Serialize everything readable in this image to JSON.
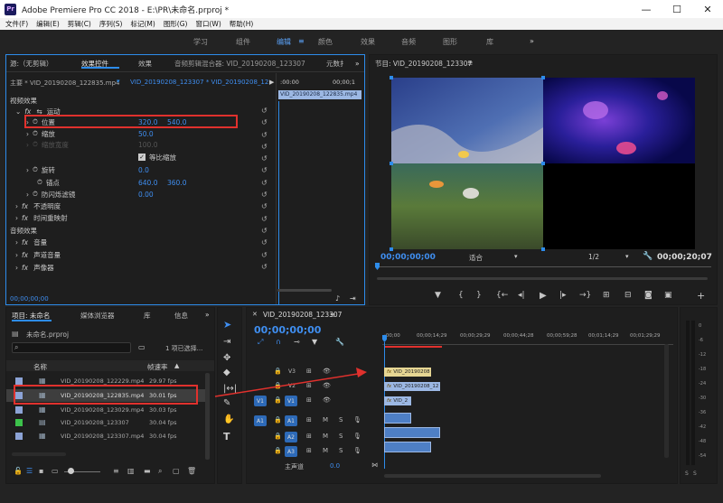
{
  "window": {
    "title": "Adobe Premiere Pro CC 2018 - E:\\PR\\未命名.prproj *",
    "logo": "Pr",
    "controls": [
      "—",
      "☐",
      "✕"
    ]
  },
  "menu": [
    "文件(F)",
    "编辑(E)",
    "剪辑(C)",
    "序列(S)",
    "标记(M)",
    "图形(G)",
    "窗口(W)",
    "帮助(H)"
  ],
  "workspaces": [
    "学习",
    "组件",
    "编辑",
    "颜色",
    "效果",
    "音频",
    "图形",
    "库"
  ],
  "workspace_more": "»",
  "source_panel": {
    "tabs": [
      "源:（无剪辑）",
      "效果控件",
      "效果",
      "音频剪辑混合器: VID_20190208_123307",
      "元数扌"
    ],
    "more": "»",
    "master_label": "主要 * VID_20190208_122835.mp4",
    "sequence_label": "VID_20190208_123307 * VID_20190208_122...",
    "timecode_start": ":00:00",
    "timecode_end": "00;00;1",
    "clip_name": "VID_20190208_122835.mp4",
    "video_effects": "视频效果",
    "motion": "运动",
    "position": {
      "label": "位置",
      "x": "320.0",
      "y": "540.0"
    },
    "scale": {
      "label": "缩放",
      "value": "50.0"
    },
    "scale_width": {
      "label": "缩放宽度",
      "value": "100.0"
    },
    "uniform_scale": "等比缩放",
    "rotation": {
      "label": "旋转",
      "value": "0.0"
    },
    "anchor": {
      "label": "锚点",
      "x": "640.0",
      "y": "360.0"
    },
    "flicker": {
      "label": "防闪烁滤镜",
      "value": "0.00"
    },
    "opacity": "不透明度",
    "time_remap": "时间重映射",
    "audio_effects": "音频效果",
    "volume": "音量",
    "channel_volume": "声道音量",
    "panner": "声像器",
    "footer_time": "00;00;00;00"
  },
  "program_panel": {
    "tab": "节目: VID_20190208_123307",
    "tab_menu": "≡",
    "timecode": "00;00;00;00",
    "fit": "适合",
    "resolution": "1/2",
    "duration": "00;00;20;07"
  },
  "project_panel": {
    "tabs": [
      "项目: 未命名",
      "媒体浏览器",
      "库",
      "信息"
    ],
    "more": "»",
    "project_file": "未命名.prproj",
    "selection_info": "1 项已选择...",
    "col_name": "名称",
    "col_fps": "帧速率",
    "sort_arrow": "▲",
    "items": [
      {
        "name": "VID_20190208_122229.mp4",
        "fps": "29.97 fps",
        "color": "#8ca3d6"
      },
      {
        "name": "VID_20190208_122835.mp4",
        "fps": "30.01 fps",
        "color": "#8ca3d6"
      },
      {
        "name": "VID_20190208_123029.mp4",
        "fps": "30.03 fps",
        "color": "#8ca3d6"
      },
      {
        "name": "VID_20190208_123307",
        "fps": "30.04 fps",
        "color": "#3cc24b"
      },
      {
        "name": "VID_20190208_123307.mp4",
        "fps": "30.04 fps",
        "color": "#8ca3d6"
      }
    ]
  },
  "timeline": {
    "tab": "VID_20190208_123307",
    "tab_menu": "≡",
    "timecode": "00;00;00;00",
    "ruler": [
      ":00;00",
      "00;00;14;29",
      "00;00;29;29",
      "00;00;44;28",
      "00;00;59;28",
      "00;01;14;29",
      "00;01;29;29"
    ],
    "tracks_video": [
      {
        "name": "V3",
        "clip": "VID_20190208"
      },
      {
        "name": "V2",
        "clip": "VID_20190208_12"
      },
      {
        "name": "V1",
        "clip": "VID_2"
      }
    ],
    "tracks_audio": [
      "A1",
      "A2",
      "A3"
    ],
    "master": {
      "label": "主声道",
      "value": "0.0"
    },
    "track_labels": {
      "v1": "V1",
      "a1": "A1",
      "m": "M",
      "s": "S"
    }
  },
  "meter": [
    "0",
    "-6",
    "-12",
    "-18",
    "-24",
    "-30",
    "-36",
    "-42",
    "-48",
    "-54"
  ],
  "meter_solo": [
    "S",
    "S"
  ],
  "colors": {
    "accent": "#2d8ceb",
    "annotation": "#e0312d"
  }
}
